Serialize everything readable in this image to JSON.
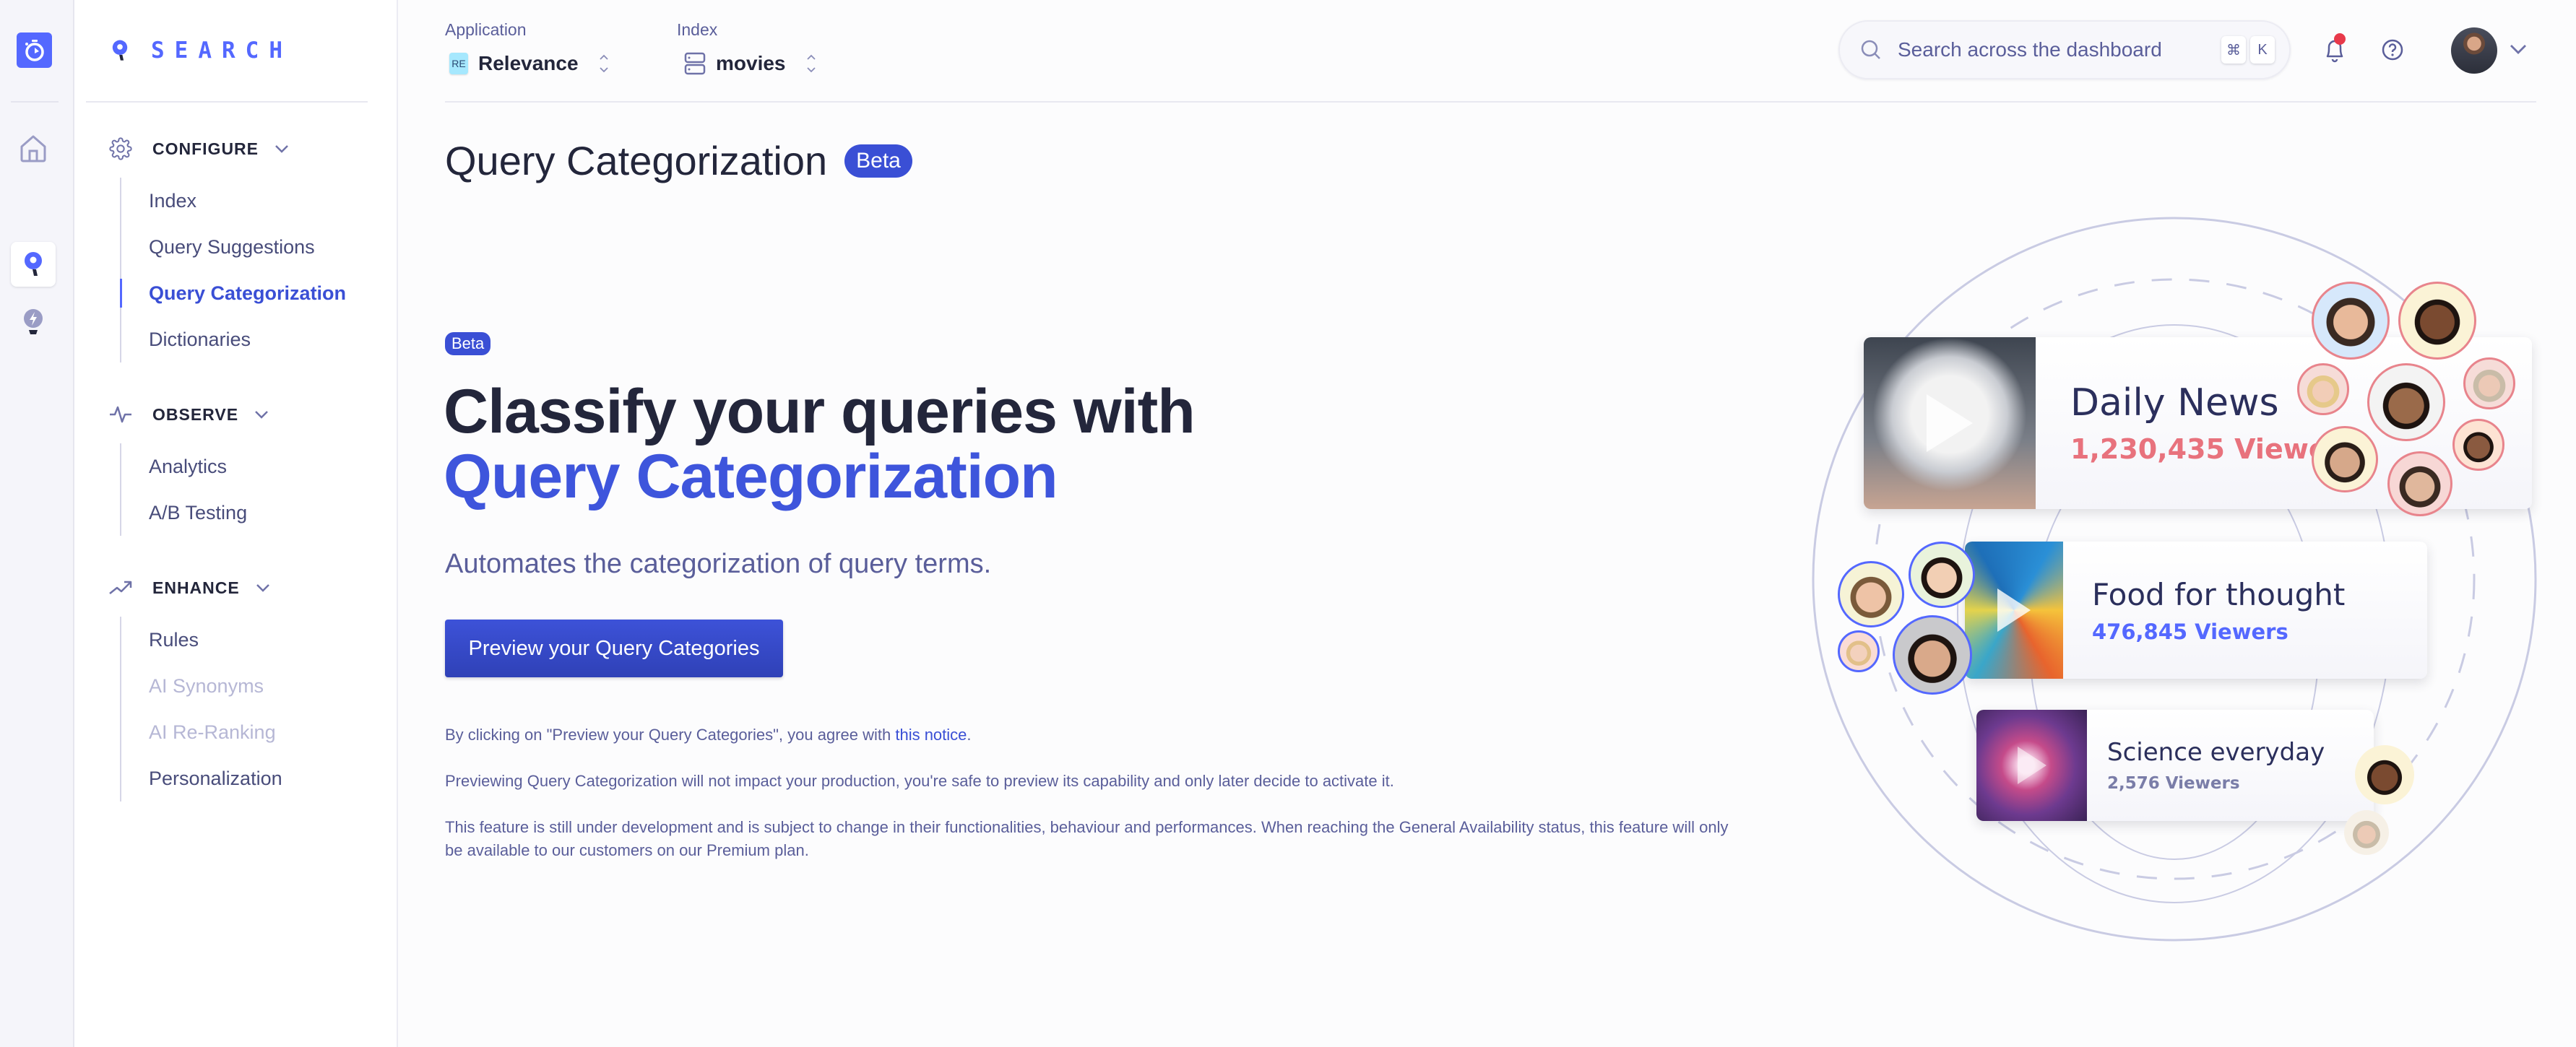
{
  "rail": {
    "items": [
      {
        "name": "home",
        "icon": "home-icon"
      },
      {
        "name": "search",
        "icon": "search-pin-icon",
        "active": true
      },
      {
        "name": "recommend",
        "icon": "lightbulb-bolt-icon"
      }
    ]
  },
  "sidebar": {
    "brand": "SEARCH",
    "sections": [
      {
        "title": "CONFIGURE",
        "icon": "gear-icon",
        "items": [
          {
            "label": "Index"
          },
          {
            "label": "Query Suggestions"
          },
          {
            "label": "Query Categorization",
            "active": true
          },
          {
            "label": "Dictionaries"
          }
        ]
      },
      {
        "title": "OBSERVE",
        "icon": "pulse-icon",
        "items": [
          {
            "label": "Analytics"
          },
          {
            "label": "A/B Testing"
          }
        ]
      },
      {
        "title": "ENHANCE",
        "icon": "trending-up-icon",
        "items": [
          {
            "label": "Rules"
          },
          {
            "label": "AI Synonyms",
            "disabled": true
          },
          {
            "label": "AI Re-Ranking",
            "disabled": true
          },
          {
            "label": "Personalization"
          }
        ]
      }
    ]
  },
  "header": {
    "application_label": "Application",
    "application_badge": "RE",
    "application_value": "Relevance",
    "index_label": "Index",
    "index_value": "movies",
    "search_placeholder": "Search across the dashboard",
    "shortcut_keys": [
      "⌘",
      "K"
    ],
    "has_notifications": true
  },
  "page": {
    "title": "Query Categorization",
    "badge": "Beta"
  },
  "hero": {
    "badge": "Beta",
    "heading_line1": "Classify your queries with",
    "heading_line2": "Query Categorization",
    "subtitle": "Automates the categorization of query terms.",
    "cta_label": "Preview your Query Categories",
    "notice_prefix": "By clicking on \"Preview your Query Categories\", you agree with ",
    "notice_link": "this notice",
    "notice_suffix": ".",
    "note_preview": "Previewing Query Categorization will not impact your production, you're safe to preview its capability and only later decide to activate it.",
    "note_development": "This feature is still under development and is subject to change in their functionalities, behaviour and performances. When reaching the General Availability status, this feature will only be available to our customers on our Premium plan."
  },
  "illustration": {
    "cards": [
      {
        "title": "Daily News",
        "viewers": "1,230,435 Viewers",
        "color": "#e8727d"
      },
      {
        "title": "Food for thought",
        "viewers": "476,845 Viewers",
        "color": "#5468ff"
      },
      {
        "title": "Science everyday",
        "viewers": "2,576 Viewers",
        "color": "#7a7da8"
      }
    ]
  },
  "colors": {
    "accent": "#5468ff",
    "primary_button": "#3a4fd5",
    "text_dark": "#23263b",
    "text_muted": "#5a5e9a",
    "notification": "#e8394a"
  }
}
